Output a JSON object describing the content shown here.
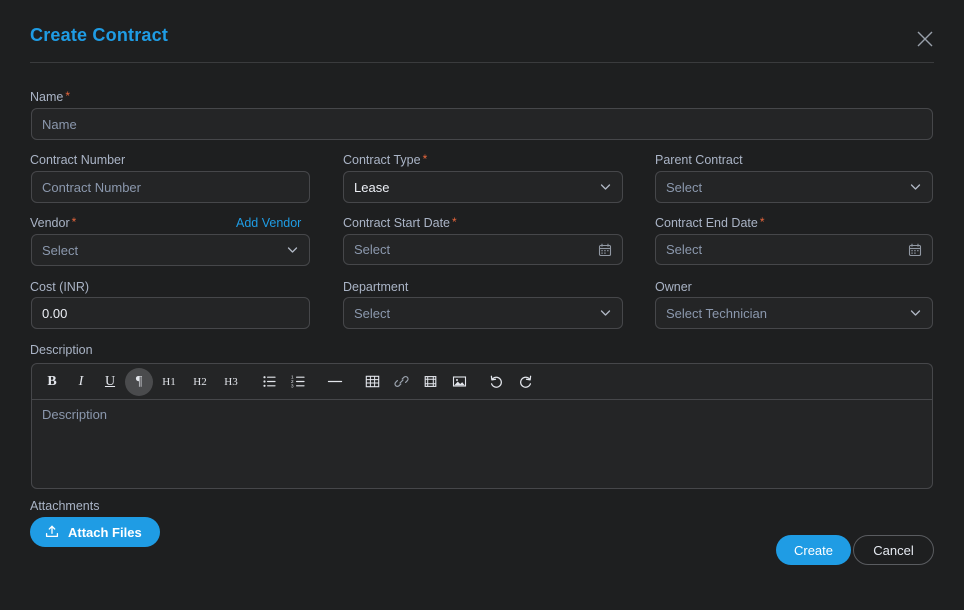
{
  "header": {
    "title": "Create Contract",
    "close_icon": "close-icon"
  },
  "form": {
    "name": {
      "label": "Name",
      "required": true,
      "placeholder": "Name",
      "value": ""
    },
    "contract_number": {
      "label": "Contract Number",
      "required": false,
      "placeholder": "Contract Number",
      "value": ""
    },
    "contract_type": {
      "label": "Contract Type",
      "required": true,
      "value": "Lease",
      "icon": "chevron-down-icon"
    },
    "parent_contract": {
      "label": "Parent Contract",
      "required": false,
      "placeholder": "Select",
      "icon": "chevron-down-icon"
    },
    "vendor": {
      "label": "Vendor",
      "required": true,
      "placeholder": "Select",
      "icon": "chevron-down-icon",
      "action_label": "Add Vendor"
    },
    "contract_start_date": {
      "label": "Contract Start Date",
      "required": true,
      "placeholder": "Select",
      "icon": "calendar-icon"
    },
    "contract_end_date": {
      "label": "Contract End Date",
      "required": true,
      "placeholder": "Select",
      "icon": "calendar-icon"
    },
    "cost": {
      "label": "Cost (INR)",
      "required": false,
      "value": "0.00"
    },
    "department": {
      "label": "Department",
      "required": false,
      "placeholder": "Select",
      "icon": "chevron-down-icon"
    },
    "owner": {
      "label": "Owner",
      "required": false,
      "placeholder": "Select Technician",
      "icon": "chevron-down-icon"
    },
    "description": {
      "label": "Description",
      "placeholder": "Description",
      "value": ""
    },
    "attachments": {
      "label": "Attachments",
      "button_label": "Attach Files",
      "button_icon": "upload-icon"
    }
  },
  "editor_toolbar": {
    "items": [
      {
        "name": "bold-icon",
        "label": "B",
        "active": false
      },
      {
        "name": "italic-icon",
        "label": "I",
        "active": false
      },
      {
        "name": "underline-icon",
        "label": "U",
        "active": false
      },
      {
        "name": "paragraph-icon",
        "label": "¶",
        "active": true
      },
      {
        "name": "heading-1-icon",
        "label": "H1",
        "active": false
      },
      {
        "name": "heading-2-icon",
        "label": "H2",
        "active": false
      },
      {
        "name": "heading-3-icon",
        "label": "H3",
        "active": false
      },
      {
        "name": "bullet-list-icon",
        "label": "",
        "active": false
      },
      {
        "name": "numbered-list-icon",
        "label": "",
        "active": false
      },
      {
        "name": "horizontal-rule-icon",
        "label": "",
        "active": false
      },
      {
        "name": "table-icon",
        "label": "",
        "active": false
      },
      {
        "name": "link-icon",
        "label": "",
        "active": false
      },
      {
        "name": "video-icon",
        "label": "",
        "active": false
      },
      {
        "name": "image-icon",
        "label": "",
        "active": false
      },
      {
        "name": "undo-icon",
        "label": "",
        "active": false
      },
      {
        "name": "redo-icon",
        "label": "",
        "active": false
      }
    ]
  },
  "actions": {
    "create_label": "Create",
    "cancel_label": "Cancel"
  },
  "colors": {
    "accent": "#1f9ce4",
    "required": "#e8663c",
    "background": "#1e1f20",
    "field_background": "#242526",
    "border": "#46474a",
    "label": "#aab4c6",
    "placeholder": "#8b98ad"
  }
}
